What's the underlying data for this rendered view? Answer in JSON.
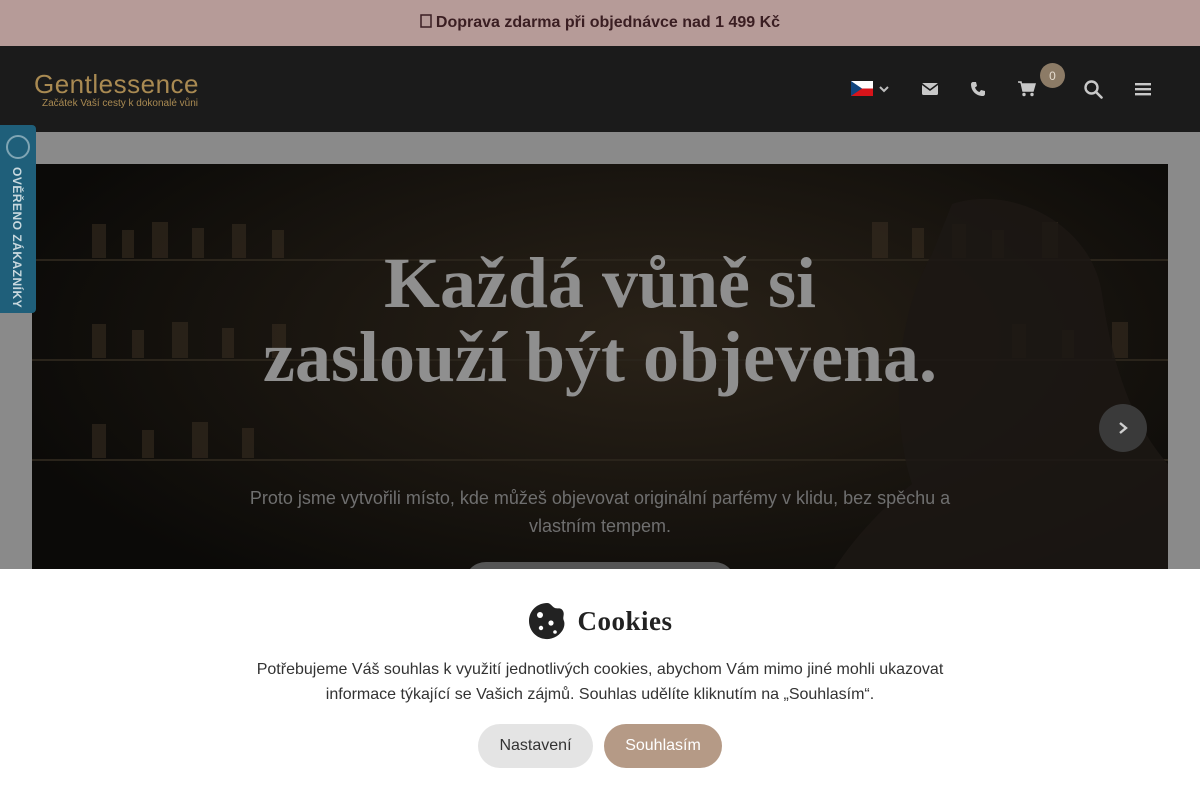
{
  "topbar": {
    "icon": "truck-icon",
    "message": "Doprava zdarma při objednávce nad 1 499 Kč"
  },
  "header": {
    "logo_brand": "Gentlessence",
    "logo_tagline": "Začátek Vaší cesty k dokonalé vůni",
    "language_icon": "czech-flag-icon",
    "cart_count": "0",
    "icons": [
      "envelope-icon",
      "phone-icon",
      "cart-icon",
      "search-icon",
      "menu-icon"
    ]
  },
  "verified_badge": {
    "label": "OVĚŘENO ZÁKAZNÍKY"
  },
  "hero": {
    "title": "Každá vůně si zaslouží být objevena.",
    "subtitle": "Proto jsme vytvořili místo, kde můžeš objevovat originální parfémy v klidu, bez spěchu a vlastním tempem."
  },
  "cookie_bar": {
    "title": "Cookies",
    "text": "Potřebujeme Váš souhlas k využití jednotlivých cookies, abychom Vám mimo jiné mohli ukazovat informace týkající se Vašich zájmů. Souhlas udělíte kliknutím na „Souhlasím“.",
    "settings_label": "Nastavení",
    "agree_label": "Souhlasím"
  },
  "colors": {
    "topbar_bg": "#b69b98",
    "header_bg": "#1b1b1b",
    "logo_gold": "#a98a52",
    "agree_button": "#b59a86",
    "verified_tab": "#1f5f7a"
  }
}
